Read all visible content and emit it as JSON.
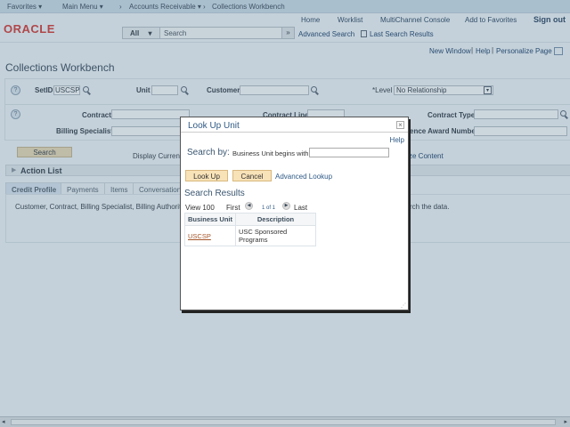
{
  "nav": {
    "favorites": "Favorites ▾",
    "main_menu": "Main Menu ▾",
    "sep1": "›",
    "accounts_receivable": "Accounts Receivable ▾",
    "sep2": "›",
    "collections_workbench": "Collections Workbench"
  },
  "header": {
    "logo": "ORACLE",
    "links": [
      "Home",
      "Worklist",
      "MultiChannel Console",
      "Add to Favorites",
      "Sign out"
    ],
    "search_scope": "All",
    "search_placeholder": "Search",
    "advanced_search": "Advanced Search",
    "last_search_results": "Last Search Results"
  },
  "page_links": [
    "New Window",
    "Help",
    "Personalize Page"
  ],
  "page_title": "Collections Workbench",
  "criteria": {
    "setid_label": "SetID",
    "setid_value": "USCSP",
    "unit_label": "Unit",
    "customer_label": "Customer",
    "level_label": "*Level",
    "level_value": "No Relationship",
    "contract_label": "Contract",
    "contract_line_label": "Contract Line",
    "contract_type_label": "Contract Type",
    "billing_specialist_label": "Billing Specialist",
    "award_label": "ence Award Number"
  },
  "search_button": "Search",
  "display_currency": "Display Curreno",
  "personalize_content": "ze Content",
  "action_list": "Action List",
  "tabs": [
    "Credit Profile",
    "Payments",
    "Items",
    "Conversations"
  ],
  "content_text_left": "Customer, Contract, Billing Specialist, Billing Authority,",
  "content_text_right": "rch the data.",
  "modal": {
    "title": "Look Up Unit",
    "close": "×",
    "help": "Help",
    "search_by": "Search by:",
    "field_label": "Business Unit begins with",
    "field_value": "",
    "lookup_button": "Look Up",
    "cancel_button": "Cancel",
    "advanced_lookup": "Advanced Lookup",
    "results_title": "Search Results",
    "view": "View 100",
    "first": "First",
    "page_info": "1 of 1",
    "last": "Last",
    "columns": [
      "Business Unit",
      "Description"
    ],
    "rows": [
      {
        "unit": "USCSP",
        "description": "USC Sponsored Programs"
      }
    ]
  }
}
